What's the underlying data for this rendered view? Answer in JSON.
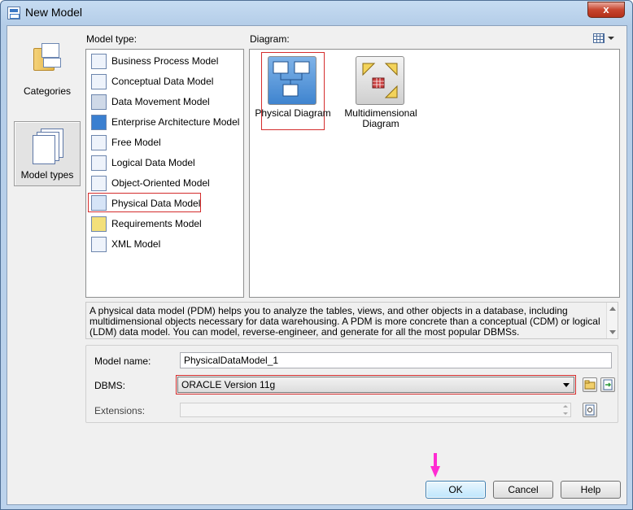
{
  "window": {
    "title": "New Model",
    "close_glyph": "x"
  },
  "rail": {
    "items": [
      {
        "label": "Categories",
        "icon": "categories-folder-icon",
        "selected": false
      },
      {
        "label": "Model types",
        "icon": "model-types-icon",
        "selected": true
      }
    ]
  },
  "model_type": {
    "label": "Model type:",
    "items": [
      {
        "label": "Business Process Model",
        "icon": "business-process-icon"
      },
      {
        "label": "Conceptual Data Model",
        "icon": "conceptual-data-icon"
      },
      {
        "label": "Data Movement Model",
        "icon": "data-movement-icon"
      },
      {
        "label": "Enterprise Architecture Model",
        "icon": "enterprise-architecture-icon"
      },
      {
        "label": "Free Model",
        "icon": "free-model-icon"
      },
      {
        "label": "Logical Data Model",
        "icon": "logical-data-icon"
      },
      {
        "label": "Object-Oriented Model",
        "icon": "object-oriented-icon"
      },
      {
        "label": "Physical Data Model",
        "icon": "physical-data-icon",
        "selected": true
      },
      {
        "label": "Requirements Model",
        "icon": "requirements-icon"
      },
      {
        "label": "XML Model",
        "icon": "xml-model-icon"
      }
    ]
  },
  "diagram": {
    "label": "Diagram:",
    "items": [
      {
        "label": "Physical Diagram",
        "icon": "physical-diagram-icon",
        "selected": true
      },
      {
        "label": "Multidimensional Diagram",
        "icon": "multidimensional-diagram-icon",
        "selected": false
      }
    ]
  },
  "description": "A physical data model (PDM) helps you to analyze the tables, views, and other objects in a database, including multidimensional objects necessary for data warehousing. A PDM is more concrete than a conceptual (CDM) or logical (LDM) data model. You can model, reverse-engineer, and generate for all the most popular DBMSs.",
  "form": {
    "model_name_label": "Model name:",
    "model_name_value": "PhysicalDataModel_1",
    "dbms_label": "DBMS:",
    "dbms_value": "ORACLE Version 11g",
    "extensions_label": "Extensions:",
    "extensions_value": ""
  },
  "buttons": {
    "ok": "OK",
    "cancel": "Cancel",
    "help": "Help"
  },
  "colors": {
    "selection_outline": "#d42d2d",
    "pointer": "#ff2bd2",
    "ok_border": "#3c7fb1"
  }
}
